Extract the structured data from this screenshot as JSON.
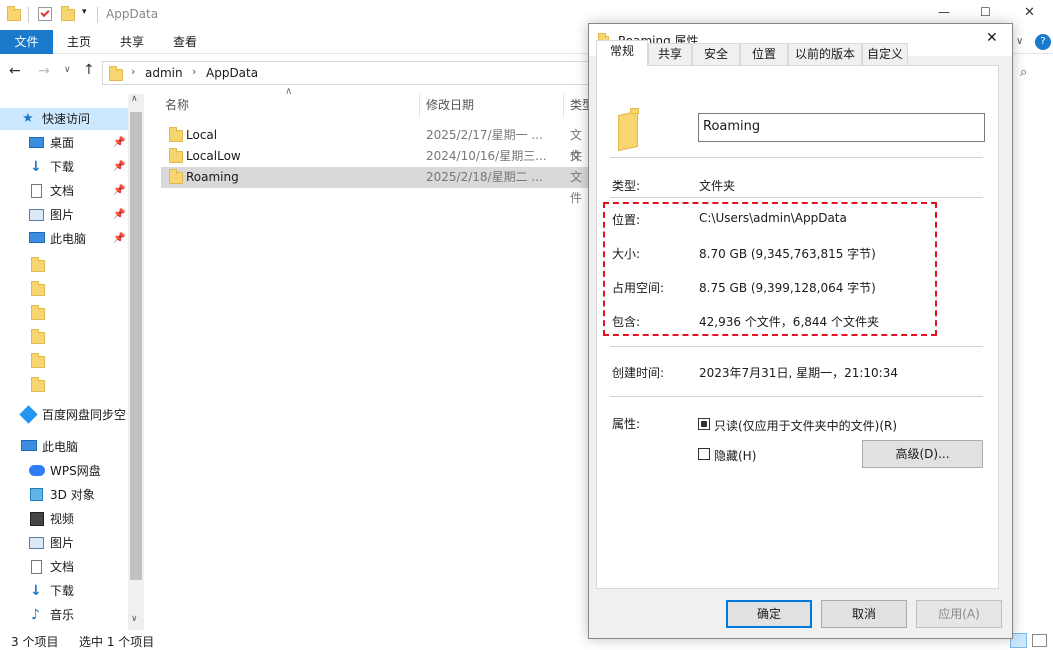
{
  "window": {
    "title": "AppData",
    "controls": {
      "minimize": "—",
      "maximize": "☐",
      "close": "✕"
    }
  },
  "ribbon": {
    "tabs": [
      "文件",
      "主页",
      "共享",
      "查看"
    ]
  },
  "address": {
    "crumbs": [
      "admin",
      "AppData"
    ]
  },
  "nav": {
    "quick_access": "快速访问",
    "pinned": [
      "桌面",
      "下载",
      "文档",
      "图片",
      "此电脑"
    ],
    "baidu": "百度网盘同步空",
    "this_pc": "此电脑",
    "pc_items": [
      "WPS网盘",
      "3D 对象",
      "视频",
      "图片",
      "文档",
      "下载",
      "音乐"
    ]
  },
  "list": {
    "headers": {
      "name": "名称",
      "date": "修改日期",
      "type": "类型"
    },
    "rows": [
      {
        "name": "Local",
        "date": "2025/2/17/星期一 ...",
        "type": "文件"
      },
      {
        "name": "LocalLow",
        "date": "2024/10/16/星期三...",
        "type": "文件"
      },
      {
        "name": "Roaming",
        "date": "2025/2/18/星期二 ...",
        "type": "文件"
      }
    ]
  },
  "status": {
    "count": "3 个项目",
    "selected": "选中 1 个项目"
  },
  "dialog": {
    "title": "Roaming 属性",
    "tabs": [
      "常规",
      "共享",
      "安全",
      "位置",
      "以前的版本",
      "自定义"
    ],
    "name_value": "Roaming",
    "type_label": "类型:",
    "type_value": "文件夹",
    "location_label": "位置:",
    "location_value": "C:\\Users\\admin\\AppData",
    "size_label": "大小:",
    "size_value": "8.70 GB (9,345,763,815 字节)",
    "disk_label": "占用空间:",
    "disk_value": "8.75 GB (9,399,128,064 字节)",
    "contains_label": "包含:",
    "contains_value": "42,936 个文件，6,844 个文件夹",
    "created_label": "创建时间:",
    "created_value": "2023年7月31日, 星期一，21:10:34",
    "attr_label": "属性:",
    "readonly_label": "只读(仅应用于文件夹中的文件)(R)",
    "hidden_label": "隐藏(H)",
    "advanced_button": "高级(D)...",
    "ok_button": "确定",
    "cancel_button": "取消",
    "apply_button": "应用(A)"
  },
  "colors": {
    "accent": "#1979ca",
    "highlight_box": "#e81123",
    "selection": "#cce8ff"
  }
}
